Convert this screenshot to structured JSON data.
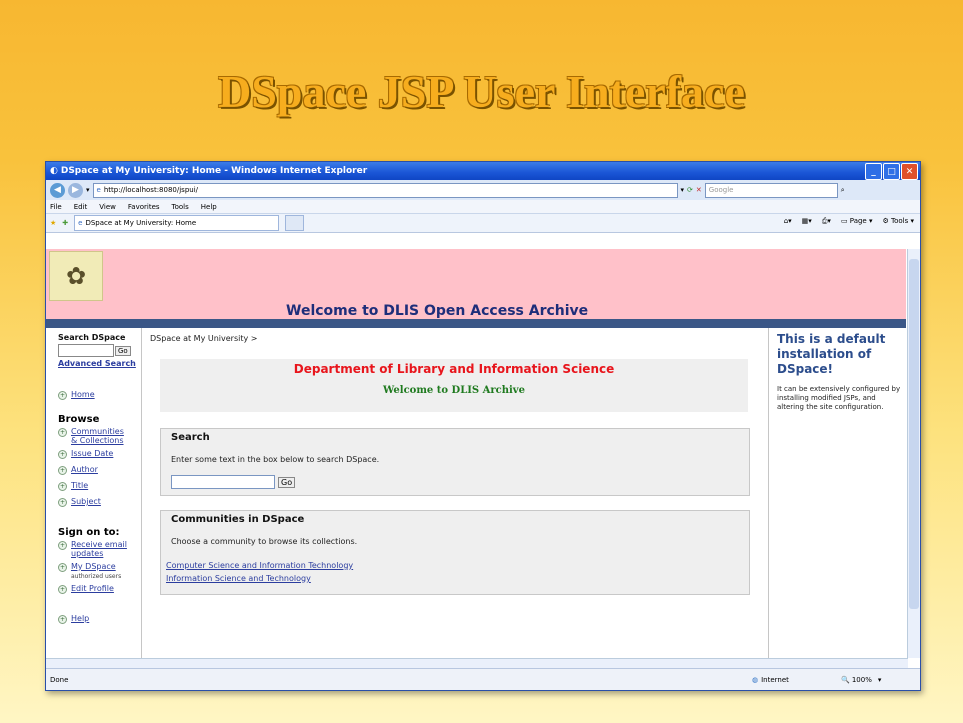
{
  "slide": {
    "title": "DSpace JSP User Interface"
  },
  "browser": {
    "window_title": "DSpace at My University: Home - Windows Internet Explorer",
    "address": "http://localhost:8080/jspui/",
    "search_placeholder": "Google",
    "menu": [
      "File",
      "Edit",
      "View",
      "Favorites",
      "Tools",
      "Help"
    ],
    "tab_label": "DSpace at My University: Home",
    "toolbar": {
      "page": "Page",
      "tools": "Tools"
    },
    "status": {
      "left": "Done",
      "zone": "Internet",
      "zoom": "100%"
    }
  },
  "page": {
    "banner_welcome": "Welcome to DLIS Open Access Archive",
    "breadcrumb": "DSpace at My University >",
    "left": {
      "search_title": "Search DSpace",
      "go_label": "Go",
      "advanced_search": "Advanced Search",
      "home": "Home",
      "browse_title": "Browse",
      "browse_items": [
        "Communities & Collections",
        "Issue Date",
        "Author",
        "Title",
        "Subject"
      ],
      "signon_title": "Sign on to:",
      "signon_items": {
        "email": "Receive email updates",
        "mydspace": "My DSpace",
        "mydspace_sub": "authorized users",
        "profile": "Edit Profile"
      },
      "help": "Help"
    },
    "dept": {
      "title": "Department of Library and Information Science",
      "subtitle": "Welcome to DLIS Archive"
    },
    "search_box": {
      "title": "Search",
      "text": "Enter some text in the box below to search DSpace.",
      "go": "Go"
    },
    "communities": {
      "title": "Communities in DSpace",
      "text": "Choose a community to browse its collections.",
      "links": [
        "Computer Science and Information Technology",
        "Information Science and Technology"
      ]
    },
    "right": {
      "heading": "This is a default installation of DSpace!",
      "text": "It can be extensively configured by installing modified JSPs, and altering the site configuration."
    }
  }
}
